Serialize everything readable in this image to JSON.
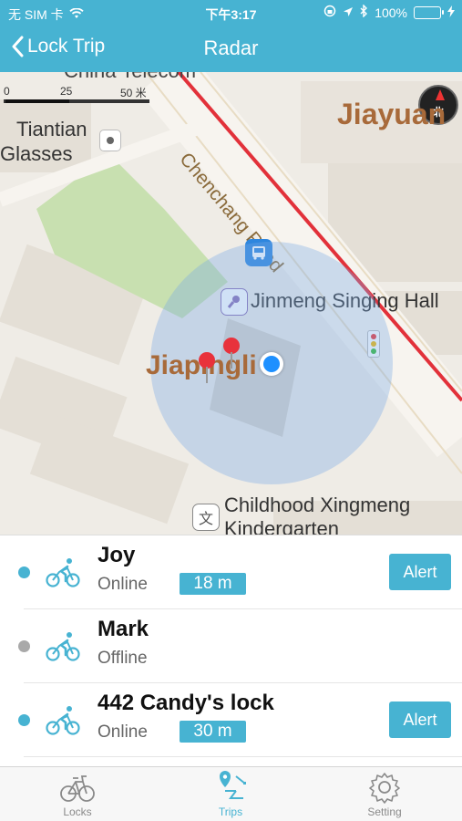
{
  "status_bar": {
    "carrier": "无 SIM 卡",
    "time": "下午3:17",
    "battery": "100%"
  },
  "nav": {
    "back_label": "Lock Trip",
    "title": "Radar"
  },
  "map": {
    "scale": {
      "tick_0": "0",
      "tick_25": "25",
      "tick_50": "50 米"
    },
    "compass": "北",
    "labels": {
      "china_telecom": "China Telecom",
      "tiantian": "Tiantian",
      "glasses": "Glasses",
      "jiayuan": "Jiayuan",
      "chenchang_road": "Chenchang Road",
      "jinmeng": "Jinmeng Singing Hall",
      "jiapingli": "Jiapingli",
      "childhood_line1": "Childhood Xingmeng",
      "childhood_line2": "Kindergarten",
      "school_icon": "文"
    }
  },
  "locks": [
    {
      "name": "Joy",
      "status": "Online",
      "distance": "18 m",
      "alert": "Alert",
      "dot_color": "#47b3d2"
    },
    {
      "name": "Mark",
      "status": "Offline",
      "distance": "",
      "alert": "",
      "dot_color": "#a9a9a9"
    },
    {
      "name": "442 Candy's lock",
      "status": "Online",
      "distance": "30 m",
      "alert": "Alert",
      "dot_color": "#47b3d2"
    }
  ],
  "tabs": [
    {
      "label": "Locks",
      "icon": "bicycle-icon",
      "active": false
    },
    {
      "label": "Trips",
      "icon": "map-route-icon",
      "active": true
    },
    {
      "label": "Setting",
      "icon": "gear-icon",
      "active": false
    }
  ],
  "colors": {
    "accent": "#47b3d2",
    "online": "#47b3d2",
    "offline": "#a9a9a9",
    "route": "#e2313a"
  }
}
